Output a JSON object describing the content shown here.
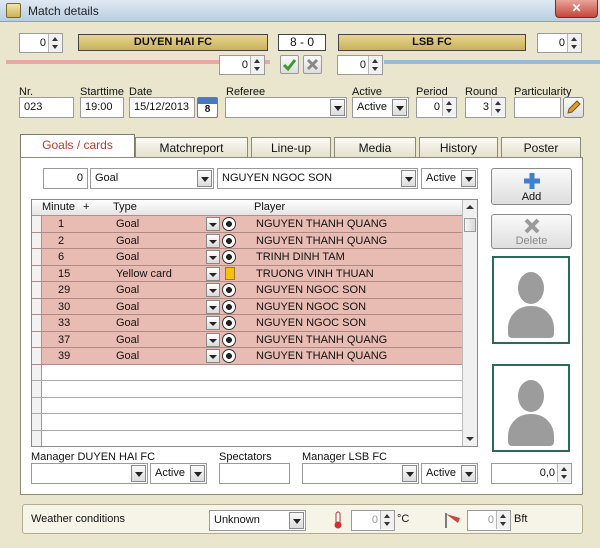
{
  "window": {
    "title": "Match details",
    "close": "✕"
  },
  "home": {
    "name": "DUYEN HAI FC",
    "spin_value": "0",
    "half_value": "0",
    "manager_label": "Manager DUYEN HAI FC",
    "manager_status": "Active"
  },
  "away": {
    "name": "LSB FC",
    "spin_value": "0",
    "half_value": "0",
    "manager_label": "Manager LSB FC",
    "manager_status": "Active"
  },
  "score": "8 - 0",
  "info": {
    "nr_label": "Nr.",
    "nr_value": "023",
    "start_label": "Starttime",
    "start_value": "19:00",
    "date_label": "Date",
    "date_value": "15/12/2013",
    "calendar_day": "8",
    "referee_label": "Referee",
    "referee_value": "",
    "active_label": "Active",
    "active_value": "Active",
    "period_label": "Period",
    "period_value": "0",
    "round_label": "Round",
    "round_value": "3",
    "particularity_label": "Particularity",
    "particularity_value": ""
  },
  "tabs": [
    "Goals / cards",
    "Matchreport",
    "Line-up",
    "Media",
    "History",
    "Poster"
  ],
  "entry": {
    "minute": "0",
    "type": "Goal",
    "player": "NGUYEN NGOC SON",
    "status": "Active"
  },
  "buttons": {
    "add": "Add",
    "delete": "Delete"
  },
  "grid": {
    "headers": {
      "minute": "Minute",
      "plus": "+",
      "type": "Type",
      "player": "Player"
    },
    "rows": [
      {
        "minute": "1",
        "type": "Goal",
        "icon": "ball",
        "player": "NGUYEN THANH QUANG"
      },
      {
        "minute": "2",
        "type": "Goal",
        "icon": "ball",
        "player": "NGUYEN THANH QUANG"
      },
      {
        "minute": "6",
        "type": "Goal",
        "icon": "ball",
        "player": "TRINH DINH TAM"
      },
      {
        "minute": "15",
        "type": "Yellow card",
        "icon": "yellow-card",
        "player": "TRUONG VINH THUAN"
      },
      {
        "minute": "29",
        "type": "Goal",
        "icon": "ball",
        "player": "NGUYEN NGOC SON"
      },
      {
        "minute": "30",
        "type": "Goal",
        "icon": "ball",
        "player": "NGUYEN NGOC SON"
      },
      {
        "minute": "33",
        "type": "Goal",
        "icon": "ball",
        "player": "NGUYEN NGOC SON"
      },
      {
        "minute": "37",
        "type": "Goal",
        "icon": "ball",
        "player": "NGUYEN THANH QUANG"
      },
      {
        "minute": "39",
        "type": "Goal",
        "icon": "ball",
        "player": "NGUYEN THANH QUANG"
      }
    ]
  },
  "spectators": {
    "label": "Spectators",
    "value": ""
  },
  "rating": "0,0",
  "weather": {
    "label": "Weather conditions",
    "condition": "Unknown",
    "temp_value": "0",
    "temp_unit": "°C",
    "wind_value": "0",
    "wind_unit": "Bft"
  },
  "colors": {
    "home_bar": "#e8a8a8",
    "away_bar": "#9bb9d4",
    "row_fill": "#e8bcb3",
    "team_bar": "#d6c070"
  }
}
